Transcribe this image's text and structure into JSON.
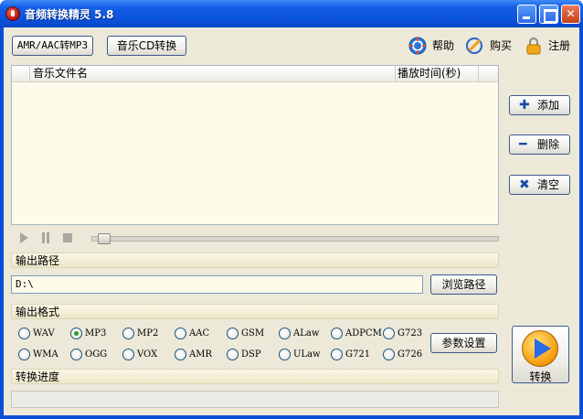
{
  "window": {
    "title": "音频转换精灵 5.8",
    "controls": {
      "minimize": "",
      "maximize": "",
      "close": "✕"
    }
  },
  "toolbar": {
    "amr_button": "AMR/AAC转MP3",
    "cd_button": "音乐CD转换",
    "help": "帮助",
    "buy": "购买",
    "register": "注册"
  },
  "file_list": {
    "columns": [
      "音乐文件名",
      "播放时间(秒)"
    ],
    "rows": []
  },
  "side_buttons": {
    "add": "添加",
    "add_symbol": "✚",
    "delete": "删除",
    "delete_symbol": "━",
    "clear": "清空",
    "clear_symbol": "✖"
  },
  "output_path": {
    "label": "输出路径",
    "value": "D:\\",
    "browse": "浏览路径"
  },
  "output_format": {
    "label": "输出格式",
    "selected": "MP3",
    "options": [
      "WAV",
      "MP3",
      "MP2",
      "AAC",
      "GSM",
      "ALaw",
      "ADPCM",
      "G723",
      "WMA",
      "OGG",
      "VOX",
      "AMR",
      "DSP",
      "ULaw",
      "G721",
      "G726"
    ],
    "settings_button": "参数设置"
  },
  "convert": {
    "button": "转换"
  },
  "progress": {
    "label": "转换进度",
    "fraction": 0
  },
  "colors": {
    "titlebar": "#0a52dc",
    "client": "#ece9d8",
    "list_bg": "#fffbea",
    "section_bg": "#f4efd6",
    "radio_on": "#21a121"
  }
}
